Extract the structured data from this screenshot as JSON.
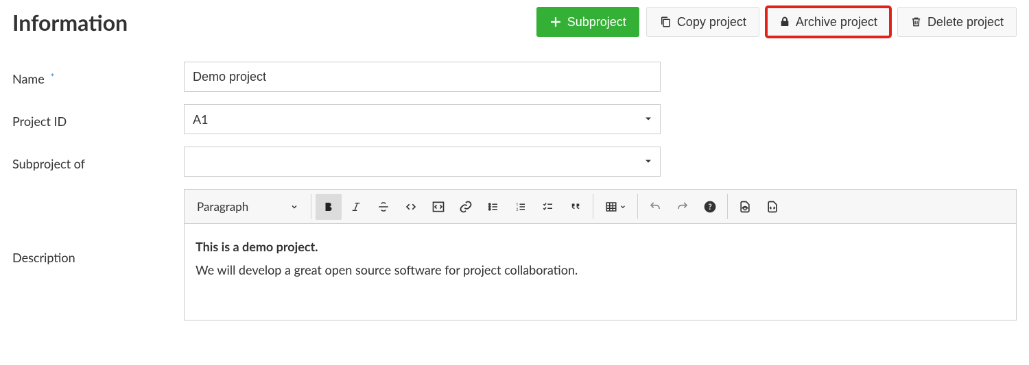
{
  "header": {
    "title": "Information"
  },
  "actions": {
    "subproject": "Subproject",
    "copy": "Copy project",
    "archive": "Archive project",
    "delete": "Delete project"
  },
  "form": {
    "name_label": "Name",
    "name_required_mark": "*",
    "name_value": "Demo project",
    "project_id_label": "Project ID",
    "project_id_value": "A1",
    "subproject_of_label": "Subproject of",
    "subproject_of_value": "",
    "description_label": "Description"
  },
  "editor": {
    "paragraph_label": "Paragraph",
    "content": {
      "bold_line": "This is a demo project.",
      "body_line": "We will develop a great open source software for project collaboration."
    }
  },
  "icons": {
    "plus": "plus",
    "copy": "copy",
    "lock": "lock",
    "trash": "trash"
  }
}
